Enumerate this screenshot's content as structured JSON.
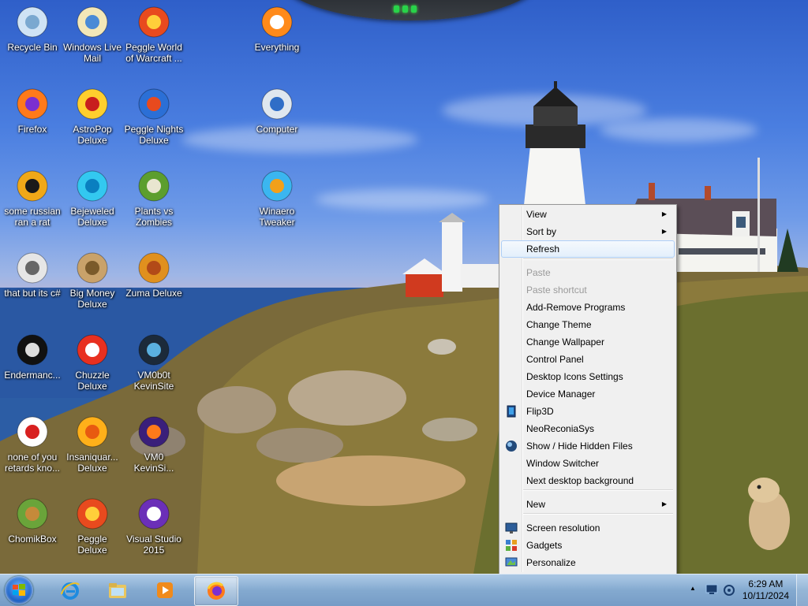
{
  "desktop": {
    "icons": [
      {
        "label": "Recycle Bin",
        "icon": "recycle-bin-icon"
      },
      {
        "label": "Windows Live\nMail",
        "icon": "mail-icon"
      },
      {
        "label": "Peggle World\nof Warcraft ...",
        "icon": "peggle-icon"
      },
      {
        "label": "Everything",
        "icon": "search-icon"
      },
      {
        "label": "Firefox",
        "icon": "firefox-icon"
      },
      {
        "label": "AstroPop\nDeluxe",
        "icon": "astropop-icon"
      },
      {
        "label": "Peggle Nights\nDeluxe",
        "icon": "peggle-nights-icon"
      },
      {
        "label": "Computer",
        "icon": "computer-icon"
      },
      {
        "label": "some russian\nran a rat",
        "icon": "de-icon"
      },
      {
        "label": "Bejeweled\nDeluxe",
        "icon": "gem-icon"
      },
      {
        "label": "Plants vs\nZombies",
        "icon": "plant-icon"
      },
      {
        "label": "Winaero\nTweaker",
        "icon": "winaero-icon"
      },
      {
        "label": "that but its c#",
        "icon": "windows-stack-icon"
      },
      {
        "label": "Big Money\nDeluxe",
        "icon": "money-bag-icon"
      },
      {
        "label": "Zuma Deluxe",
        "icon": "zuma-icon"
      },
      {
        "label": "Endermanc...",
        "icon": "terminal-icon"
      },
      {
        "label": "Chuzzle\nDeluxe",
        "icon": "chuzzle-icon"
      },
      {
        "label": "VM0b0t\nKevinSite",
        "icon": "vm-icon"
      },
      {
        "label": "none of you\nretards kno...",
        "icon": "red-dino-icon"
      },
      {
        "label": "Insaniquar...\nDeluxe",
        "icon": "fish-icon"
      },
      {
        "label": "VM0\nKevinSi...",
        "icon": "firefox-purple-icon"
      },
      {
        "label": "ChomikBox",
        "icon": "chomikbox-icon"
      },
      {
        "label": "Peggle Deluxe",
        "icon": "peggle-icon"
      },
      {
        "label": "Visual Studio\n2015",
        "icon": "visual-studio-icon"
      }
    ]
  },
  "context_menu": {
    "items": [
      {
        "label": "View",
        "submenu": true
      },
      {
        "label": "Sort by",
        "submenu": true
      },
      {
        "label": "Refresh",
        "hover": true
      },
      {
        "label": "Paste",
        "disabled": true
      },
      {
        "label": "Paste shortcut",
        "disabled": true
      },
      {
        "label": "Add-Remove Programs"
      },
      {
        "label": "Change Theme"
      },
      {
        "label": "Change Wallpaper"
      },
      {
        "label": "Control Panel"
      },
      {
        "label": "Desktop Icons Settings"
      },
      {
        "label": "Device Manager"
      },
      {
        "label": "Flip3D",
        "icon": "flip3d-icon"
      },
      {
        "label": "NeoReconiaSys"
      },
      {
        "label": "Show / Hide Hidden Files",
        "icon": "globe-icon"
      },
      {
        "label": "Window Switcher"
      },
      {
        "label": "Next desktop background"
      },
      {
        "label": "New",
        "submenu": true
      },
      {
        "label": "Screen resolution",
        "icon": "monitor-icon"
      },
      {
        "label": "Gadgets",
        "icon": "gadgets-icon"
      },
      {
        "label": "Personalize",
        "icon": "personalize-icon"
      }
    ],
    "submenu_arrow": "▶"
  },
  "taskbar": {
    "pinned": [
      {
        "name": "Internet Explorer",
        "icon": "internet-explorer-icon"
      },
      {
        "name": "Windows Explorer",
        "icon": "folder-icon"
      },
      {
        "name": "Windows Media Player",
        "icon": "media-player-icon"
      },
      {
        "name": "Firefox",
        "icon": "firefox-icon",
        "active": true
      }
    ],
    "tray": {
      "show_hidden_icons": "▲",
      "time": "6:29 AM",
      "date": "10/11/2024"
    }
  }
}
